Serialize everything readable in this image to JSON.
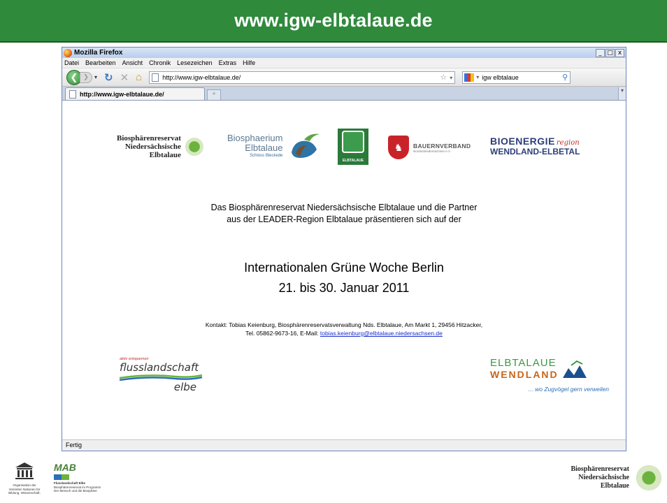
{
  "slide": {
    "title": "www.igw-elbtalaue.de"
  },
  "browser": {
    "window_title": "Mozilla Firefox",
    "window_buttons": [
      "_",
      "□",
      "x"
    ],
    "menu": [
      "Datei",
      "Bearbeiten",
      "Ansicht",
      "Chronik",
      "Lesezeichen",
      "Extras",
      "Hilfe"
    ],
    "url": "http://www.igw-elbtalaue.de/",
    "search_value": "igw elbtalaue",
    "tab_label": "http://www.igw-elbtalaue.de/",
    "status": "Fertig"
  },
  "page": {
    "logos": {
      "biosphaerenreservat": [
        "Biosphärenreservat",
        "Niedersächsische",
        "Elbtalaue"
      ],
      "biosphaerium": [
        "Biosphaerium",
        "Elbtalaue",
        "Schloss Bleckede"
      ],
      "leader": "ELBTALAUE",
      "bauernverband": "BAUERNVERBAND",
      "bauernverband_sub": "Nordostniedersachsen e.V.",
      "bioenergie_main": "BIOENERGIE",
      "bioenergie_script": "region",
      "bioenergie_sub": "WENDLAND-ELBETAL",
      "flusslandschaft_tag": "aktiv entspannen",
      "flusslandschaft_main": "flusslandschaft",
      "flusslandschaft_sub": "elbe",
      "elbtalaue_main": "ELBTALAUE",
      "elbtalaue_sub": "WENDLAND",
      "elbtalaue_slogan": "... wo Zugvögel gern verweilen"
    },
    "intro_line1": "Das Biosphärenreservat Niedersächsische Elbtalaue und die Partner",
    "intro_line2": "aus der LEADER-Region Elbtalaue präsentieren sich auf der",
    "event_line1": "Internationalen Grüne Woche Berlin",
    "event_line2": "21. bis 30. Januar 2011",
    "contact_line1": "Kontakt: Tobias Keienburg, Biosphärenreservatsverwaltung Nds. Elbtalaue, Am Markt 1, 29456 Hitzacker,",
    "contact_line2_prefix": "Tel. 05862-9673-16, E-Mail: ",
    "contact_email": "tobias.keienburg@elbtalaue.niedersachsen.de"
  },
  "footer": {
    "unesco_caption": [
      "Organisation der",
      "Vereinten Nationen für",
      "Bildung, Wissenschaft,"
    ],
    "mab_label": "MAB",
    "mab_caption": [
      "Flusslandschaft Elbe",
      "Biosphärenreservat im Programm",
      "Der Mensch und die Biosphäre"
    ],
    "right_logo": [
      "Biosphärenreservat",
      "Niedersächsische",
      "Elbtalaue"
    ]
  },
  "colors": {
    "header_green": "#2f8a3c",
    "link_blue": "#1a2fcc"
  }
}
